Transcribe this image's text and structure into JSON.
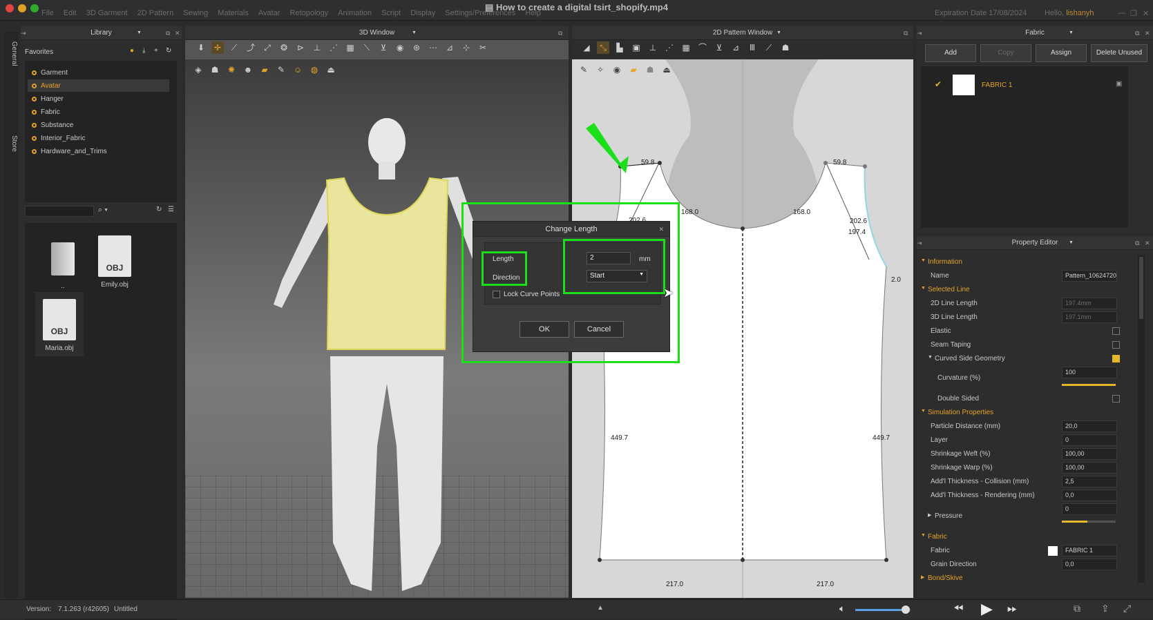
{
  "window": {
    "title": "How to create a digital tsirt_shopify.mp4",
    "menus": [
      "File",
      "Edit",
      "3D Garment",
      "2D Pattern",
      "Sewing",
      "Materials",
      "Avatar",
      "Retopology",
      "Animation",
      "Script",
      "Display",
      "Settings/Preferences",
      "Help"
    ],
    "expiration": "Expiration Date 17/08/2024",
    "hello_prefix": "Hello,",
    "hello_user": "lishanyh"
  },
  "side_tabs": [
    "General",
    "Store"
  ],
  "library": {
    "title": "Library",
    "favorites_label": "Favorites",
    "favorites": [
      "Garment",
      "Avatar",
      "Hanger",
      "Fabric",
      "Substance",
      "Interior_Fabric",
      "Hardware_and_Trims"
    ],
    "selected_favorite": "Avatar",
    "files": [
      {
        "name": "..",
        "type": "folder"
      },
      {
        "name": "Emily.obj",
        "type": "OBJ"
      },
      {
        "name": "Maria.obj",
        "type": "OBJ"
      }
    ]
  },
  "view3d": {
    "title": "3D Window"
  },
  "view2d": {
    "title": "2D Pattern Window",
    "measurements": [
      "59.8",
      "59.8",
      "168.0",
      "168.0",
      "202.6",
      "197.4",
      "2.0",
      "449.7",
      "449.7",
      "217.0",
      "217.0",
      "202.6"
    ]
  },
  "fabric_panel": {
    "title": "Fabric",
    "buttons": [
      "Add",
      "Copy",
      "Assign",
      "Delete Unused"
    ],
    "item": "FABRIC 1"
  },
  "property_editor": {
    "title": "Property Editor",
    "information": "Information",
    "name_label": "Name",
    "name_value": "Pattern_10624720",
    "selected_line": "Selected Line",
    "line2d_label": "2D Line Length",
    "line2d_value": "197.4mm",
    "line3d_label": "3D Line Length",
    "line3d_value": "197.1mm",
    "elastic": "Elastic",
    "seam_taping": "Seam Taping",
    "curved": "Curved Side Geometry",
    "curvature_label": "Curvature (%)",
    "curvature_value": "100",
    "double_sided": "Double Sided",
    "simulation": "Simulation Properties",
    "particle_label": "Particle Distance (mm)",
    "particle_value": "20,0",
    "layer_label": "Layer",
    "layer_value": "0",
    "weft_label": "Shrinkage Weft (%)",
    "weft_value": "100,00",
    "warp_label": "Shrinkage Warp (%)",
    "warp_value": "100,00",
    "coll_label": "Add'l Thickness - Collision (mm)",
    "coll_value": "2,5",
    "rend_label": "Add'l Thickness - Rendering (mm)",
    "rend_value": "0,0",
    "pressure_label": "Pressure",
    "pressure_value": "0",
    "fabric_sec": "Fabric",
    "fabric_label": "Fabric",
    "fabric_value": "FABRIC 1",
    "grain_label": "Grain Direction",
    "grain_value": "0,0",
    "bond": "Bond/Skive"
  },
  "dialog": {
    "title": "Change Length",
    "length_label": "Length",
    "length_value": "2",
    "unit": "mm",
    "direction_label": "Direction",
    "direction_value": "Start",
    "lock_label": "Lock Curve Points",
    "ok": "OK",
    "cancel": "Cancel"
  },
  "status": {
    "version_label": "Version:",
    "version": "7.1.263 (r42605)",
    "file": "Untitled"
  },
  "colors": {
    "accent": "#e5a32a",
    "highlight": "#19e019",
    "garment": "#e9e59c"
  }
}
